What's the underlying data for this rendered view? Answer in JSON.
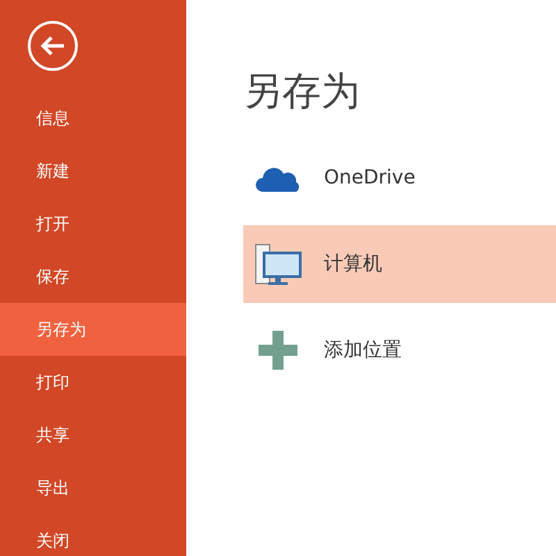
{
  "sidebar": {
    "items": [
      {
        "label": "信息",
        "selected": false
      },
      {
        "label": "新建",
        "selected": false
      },
      {
        "label": "打开",
        "selected": false
      },
      {
        "label": "保存",
        "selected": false
      },
      {
        "label": "另存为",
        "selected": true
      },
      {
        "label": "打印",
        "selected": false
      },
      {
        "label": "共享",
        "selected": false
      },
      {
        "label": "导出",
        "selected": false
      },
      {
        "label": "关闭",
        "selected": false
      }
    ]
  },
  "main": {
    "title": "另存为",
    "locations": [
      {
        "kind": "cloud",
        "label": "OneDrive",
        "selected": false
      },
      {
        "kind": "computer",
        "label": "计算机",
        "selected": true
      },
      {
        "kind": "add",
        "label": "添加位置",
        "selected": false
      }
    ]
  }
}
